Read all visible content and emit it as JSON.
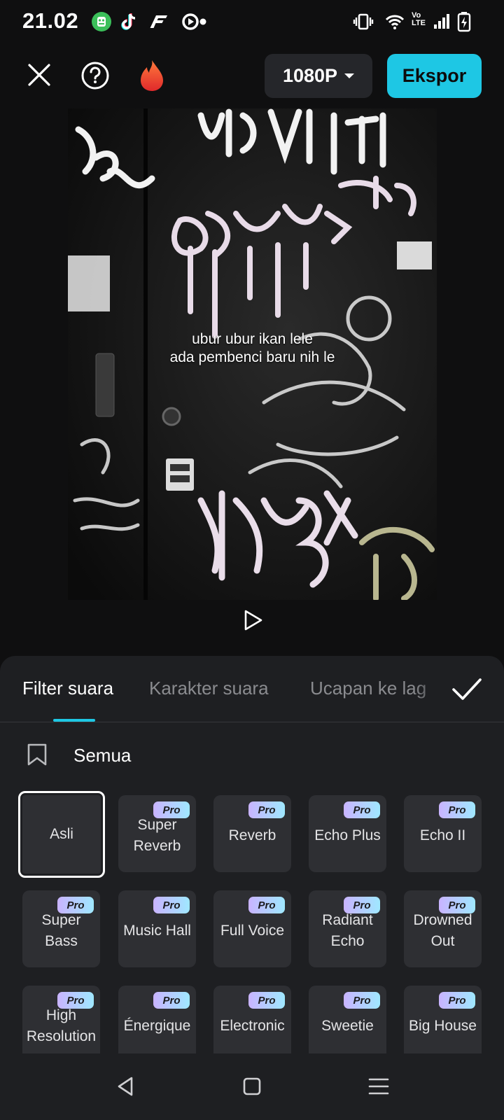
{
  "status_bar": {
    "time": "21.02",
    "volte": "Vo\nLTE"
  },
  "toolbar": {
    "resolution_label": "1080P",
    "export_label": "Ekspor"
  },
  "preview": {
    "caption_line1": "ubur ubur ikan lele",
    "caption_line2": "ada pembenci baru nih le"
  },
  "panel": {
    "tabs": [
      {
        "label": "Filter suara",
        "active": true
      },
      {
        "label": "Karakter suara",
        "active": false
      },
      {
        "label": "Ucapan ke lag",
        "active": false
      }
    ],
    "category_label": "Semua",
    "pro_badge": "Pro",
    "effects": [
      {
        "label": "Asli",
        "pro": false,
        "selected": true
      },
      {
        "label": "Super Reverb",
        "pro": true
      },
      {
        "label": "Reverb",
        "pro": true
      },
      {
        "label": "Echo Plus",
        "pro": true
      },
      {
        "label": "Echo II",
        "pro": true
      },
      {
        "label": "Super Bass",
        "pro": true
      },
      {
        "label": "Music Hall",
        "pro": true
      },
      {
        "label": "Full Voice",
        "pro": true
      },
      {
        "label": "Radiant Echo",
        "pro": true
      },
      {
        "label": "Drowned Out",
        "pro": true
      },
      {
        "label": "High Resolution",
        "pro": true
      },
      {
        "label": "Énergique",
        "pro": true
      },
      {
        "label": "Electronic",
        "pro": true
      },
      {
        "label": "Sweetie",
        "pro": true
      },
      {
        "label": "Big House",
        "pro": true
      }
    ]
  },
  "colors": {
    "accent": "#1ec7e4",
    "panel_bg": "#1e1f22",
    "card_bg": "#2e2f33"
  }
}
